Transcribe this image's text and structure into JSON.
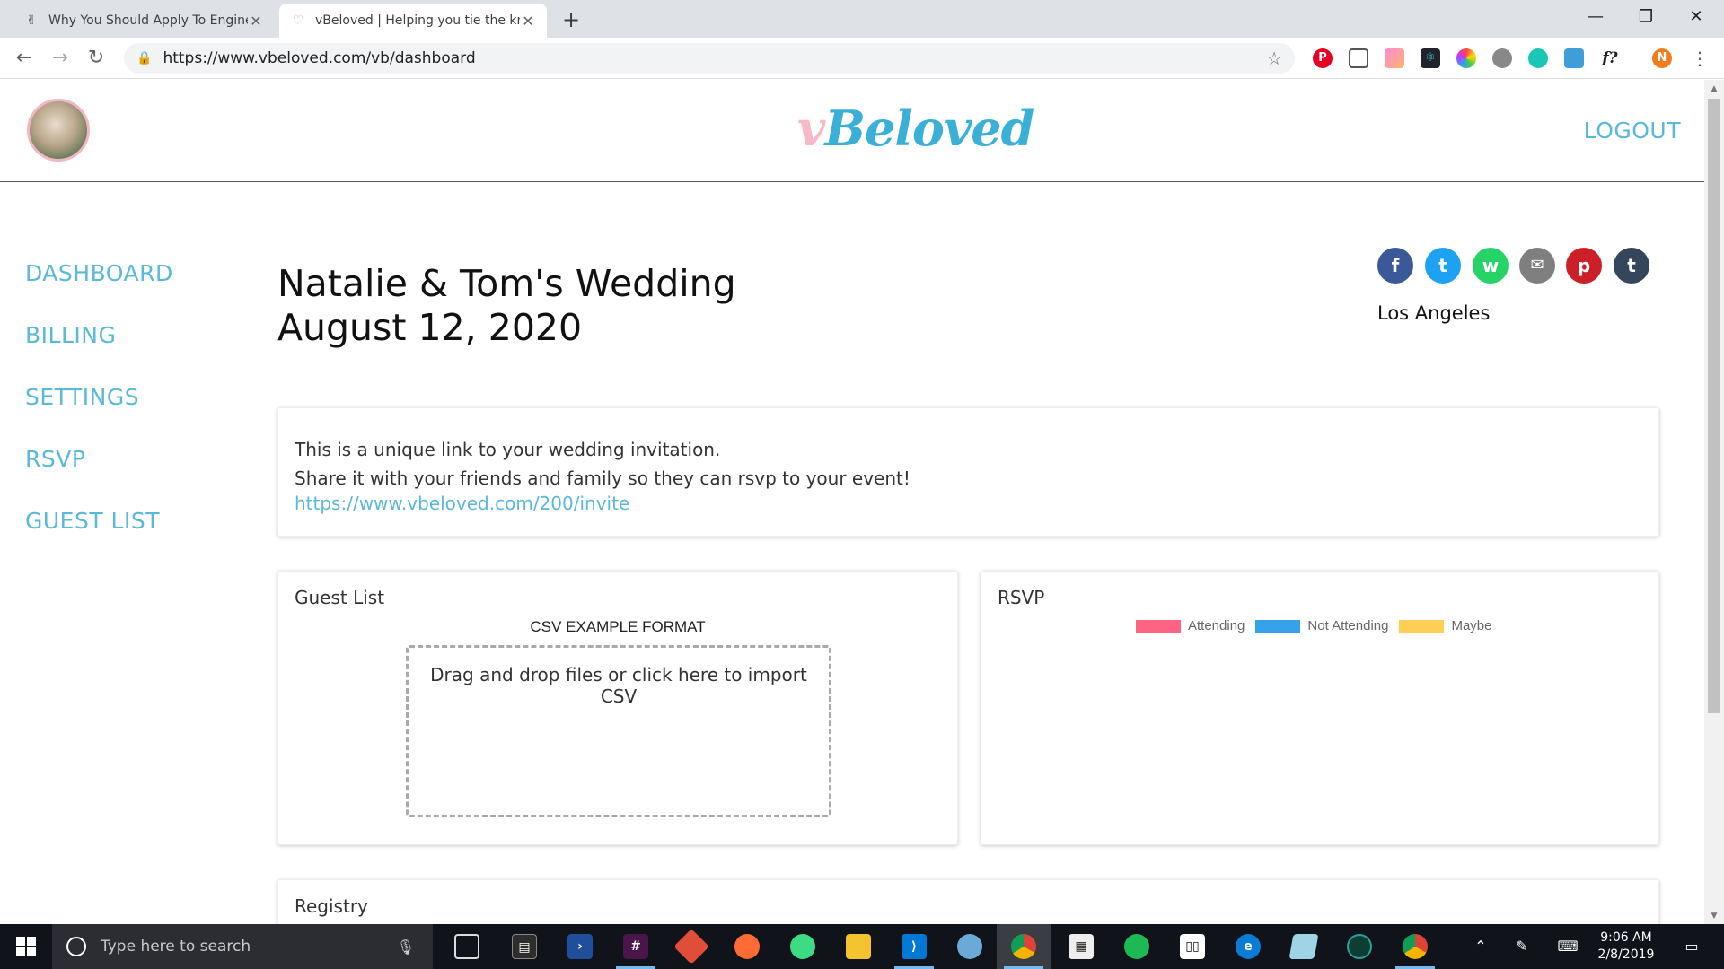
{
  "browser": {
    "tabs": [
      {
        "title": "Why You Should Apply To Engine",
        "favicon": "hand-icon"
      },
      {
        "title": "vBeloved | Helping you tie the kn",
        "favicon": "heart-icon"
      }
    ],
    "url": "https://www.vbeloved.com/vb/dashboard",
    "profile_initial": "N",
    "extensions": [
      "pinterest-icon",
      "screenshot-icon",
      "gradient-icon",
      "react-devtools-icon",
      "color-wheel-icon",
      "ghost-icon",
      "round-icon",
      "window-icon",
      "font-icon"
    ],
    "extension_font_label": "f?"
  },
  "header": {
    "logo_prefix": "v",
    "logo_rest": "Beloved",
    "logout": "LOGOUT"
  },
  "sidebar": {
    "items": [
      {
        "label": "DASHBOARD"
      },
      {
        "label": "BILLING"
      },
      {
        "label": "SETTINGS"
      },
      {
        "label": "RSVP"
      },
      {
        "label": "GUEST LIST"
      }
    ]
  },
  "event": {
    "title": "Natalie & Tom's Wedding",
    "date": "August 12, 2020",
    "location": "Los Angeles"
  },
  "share": {
    "icons": [
      {
        "name": "facebook-icon",
        "glyph": "f",
        "color": "#3b5998"
      },
      {
        "name": "twitter-icon",
        "glyph": "t",
        "color": "#1da1f2"
      },
      {
        "name": "whatsapp-icon",
        "glyph": "w",
        "color": "#25d366"
      },
      {
        "name": "email-icon",
        "glyph": "✉",
        "color": "#7f7f7f"
      },
      {
        "name": "pinterest-icon",
        "glyph": "p",
        "color": "#cb2027"
      },
      {
        "name": "tumblr-icon",
        "glyph": "t",
        "color": "#35465c"
      }
    ]
  },
  "invite": {
    "line1": "This is a unique link to your wedding invitation.",
    "line2": "Share it with your friends and family so they can rsvp to your event!",
    "link": "https://www.vbeloved.com/200/invite"
  },
  "guest_list": {
    "title": "Guest List",
    "csv_label": "CSV EXAMPLE FORMAT",
    "dropzone": "Drag and drop files or click here to import CSV"
  },
  "rsvp": {
    "title": "RSVP",
    "legend": [
      {
        "label": "Attending",
        "color": "#ff6384"
      },
      {
        "label": "Not Attending",
        "color": "#36a2eb"
      },
      {
        "label": "Maybe",
        "color": "#ffce56"
      }
    ]
  },
  "registry": {
    "title": "Registry"
  },
  "taskbar": {
    "search_placeholder": "Type here to search",
    "time": "9:06 AM",
    "date": "2/8/2019"
  },
  "colors": {
    "accent": "#5ab8d8",
    "logo_pink": "#f8b9c6",
    "logo_blue": "#3bb0d6"
  }
}
